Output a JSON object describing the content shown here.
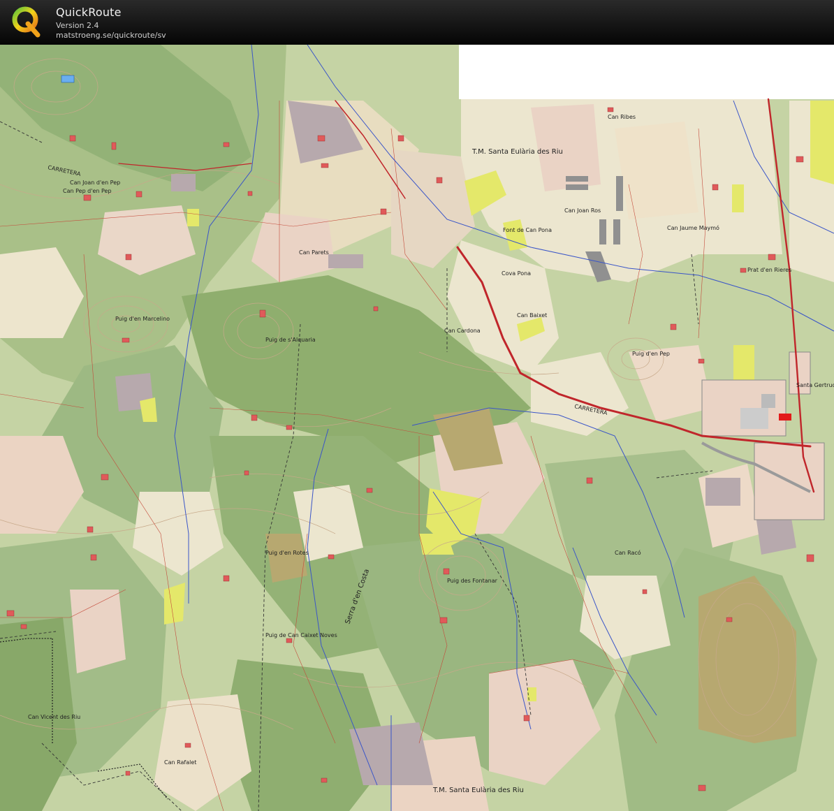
{
  "header": {
    "title": "QuickRoute",
    "version": "Version 2.4",
    "url": "matstroeng.se/quickroute/sv"
  },
  "icons": {
    "logo": "quickroute-q-logo"
  },
  "colors": {
    "header_bg": "#111111",
    "forest_dark": "#8fae6e",
    "forest_light": "#b9cc91",
    "field_cream": "#ece6cf",
    "field_pink": "#ead3c5",
    "vineyard_yellow": "#e4e86a",
    "purple_plot": "#b7a9ad",
    "olive_plot": "#b7a870",
    "road_red": "#c0262b",
    "stream_blue": "#3a55c8",
    "building_red": "#e05a5a",
    "route_red": "#c31e22"
  },
  "map": {
    "labels": {
      "municipality_north": "T.M. Santa Eulària des Riu",
      "municipality_south": "T.M. Santa Eulària des Riu",
      "puig_den_marcelino": "Puig d'en Marcelino",
      "puig_de_salquaria": "Puig de s'Alquaria",
      "puig_den_rotes": "Puig d'en Rotes",
      "puig_des_fontanar": "Puig des Fontanar",
      "puig_den_pep": "Puig d'en Pep",
      "serra_den_costa": "Serra d'en Costa",
      "pla_den_rieres": "Prat d'en Rieres",
      "carretera_1": "CARRETERA",
      "carretera_2": "CARRETERA",
      "santa_gertrudis": "Santa Gertrudis de Fruitera",
      "can_jaume_maymo": "Can Jaume Maymó",
      "can_juan_ros": "Can Joan Ros",
      "can_pep_den_pep": "Can Pep d'en Pep",
      "can_joan_den_pep": "Can Joan d'en Pep",
      "can_pacos": "Can Parets",
      "can_baixe": "Can Baixet",
      "can_cardona": "Can Cardona",
      "cova_pona": "Cova Pona",
      "can_noves": "Puig de Can Caixet Noves",
      "can_vicent": "Can Vicent des Riu",
      "can_raco": "Can Racó",
      "font_can_pona": "Font de Can Pona",
      "can_ribas": "Can Ribes",
      "can_rafalet": "Can Rafalet"
    }
  }
}
